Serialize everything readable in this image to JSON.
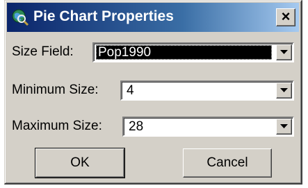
{
  "dialog": {
    "title": "Pie Chart Properties",
    "close_label": "×"
  },
  "fields": {
    "size_field": {
      "label": "Size Field:",
      "value": "Pop1990"
    },
    "minimum_size": {
      "label": "Minimum Size:",
      "value": "4"
    },
    "maximum_size": {
      "label": "Maximum Size:",
      "value": "28"
    }
  },
  "buttons": {
    "ok_label": "OK",
    "cancel_label": "Cancel"
  },
  "icons": {
    "app": "globe-magnifier-icon",
    "dropdown": "chevron-down-icon"
  },
  "colors": {
    "titlebar_start": "#0a246a",
    "titlebar_end": "#a6caf0",
    "face": "#d4d0c8",
    "selection": "#000000"
  }
}
